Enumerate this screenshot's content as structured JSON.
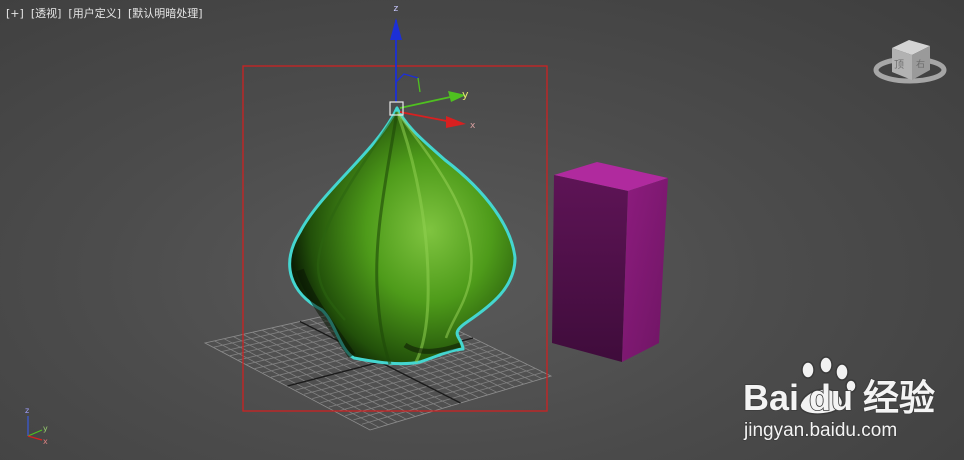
{
  "viewport": {
    "labels": [
      "[+]",
      "[透视]",
      "[用户定义]",
      "[默认明暗处理]"
    ]
  },
  "gizmo": {
    "axes": [
      "z",
      "y",
      "x"
    ]
  },
  "viewcube": {
    "faces": [
      "顶",
      "右"
    ]
  },
  "corner_axes": {
    "axes": [
      "z",
      "y",
      "x"
    ]
  },
  "watermark": {
    "brand": "Bai du 经验",
    "url": "jingyan.baidu.com"
  },
  "colors": {
    "selection_box": "#cc2222",
    "object_green": "#4e9b1a",
    "object_outline": "#44d6d0",
    "box_magenta": "#8a1a78",
    "axis_x": "#d82020",
    "axis_y": "#4fc020",
    "axis_z": "#1c2fd6"
  }
}
